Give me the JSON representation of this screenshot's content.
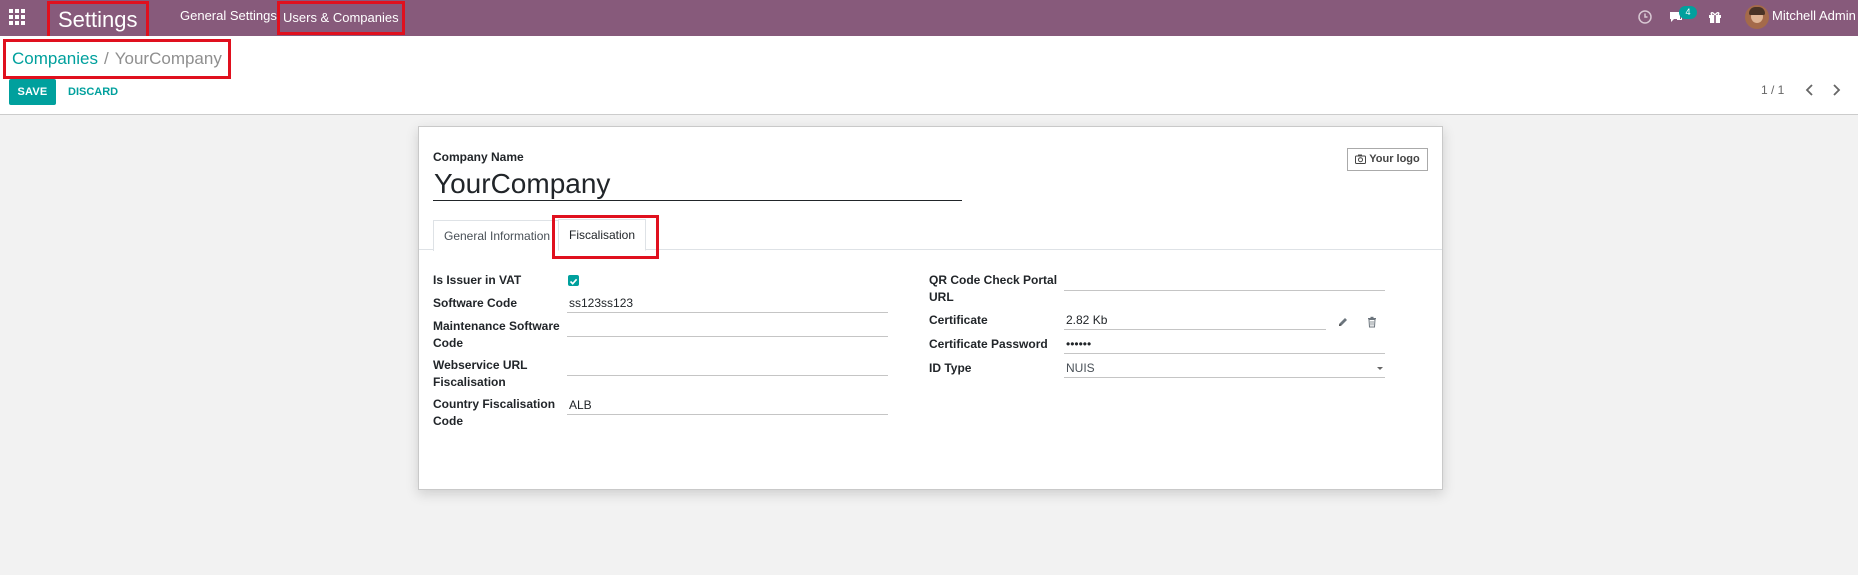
{
  "navbar": {
    "app_title": "Settings",
    "menu": {
      "general_settings": "General Settings",
      "users_companies": "Users & Companies"
    },
    "messages_badge": "4",
    "user_name": "Mitchell Admin",
    "icons": [
      "apps-icon",
      "clock-icon",
      "chat-icon",
      "gift-icon",
      "avatar"
    ]
  },
  "breadcrumb": {
    "parent": "Companies",
    "separator": "/",
    "current": "YourCompany"
  },
  "actions": {
    "save_label": "SAVE",
    "discard_label": "DISCARD"
  },
  "pager": {
    "value": "1 / 1"
  },
  "form": {
    "company_name_label": "Company Name",
    "company_name": "YourCompany",
    "logo_button_label": "Your logo",
    "tabs": [
      {
        "label": "General Information",
        "active": false
      },
      {
        "label": "Fiscalisation",
        "active": true
      }
    ],
    "left_fields": {
      "is_issuer_vat": {
        "label": "Is Issuer in VAT",
        "checked": true
      },
      "software_code": {
        "label": "Software Code",
        "value": "ss123ss123"
      },
      "maintenance_software_code": {
        "label_line1": "Maintenance Software",
        "label_line2": "Code",
        "value": ""
      },
      "webservice_url": {
        "label_line1": "Webservice URL",
        "label_line2": "Fiscalisation",
        "value": ""
      },
      "country_code": {
        "label_line1": "Country Fiscalisation",
        "label_line2": "Code",
        "value": "ALB"
      }
    },
    "right_fields": {
      "qr_code_url": {
        "label_line1": "QR Code Check Portal",
        "label_line2": "URL",
        "value": ""
      },
      "certificate": {
        "label": "Certificate",
        "value": "2.82 Kb"
      },
      "certificate_password": {
        "label": "Certificate Password",
        "value": "••••••"
      },
      "id_type": {
        "label": "ID Type",
        "value": "NUIS"
      }
    }
  },
  "colors": {
    "navbar": "#875a7b",
    "accent": "#00a09d",
    "highlight_box": "#e0101e"
  }
}
